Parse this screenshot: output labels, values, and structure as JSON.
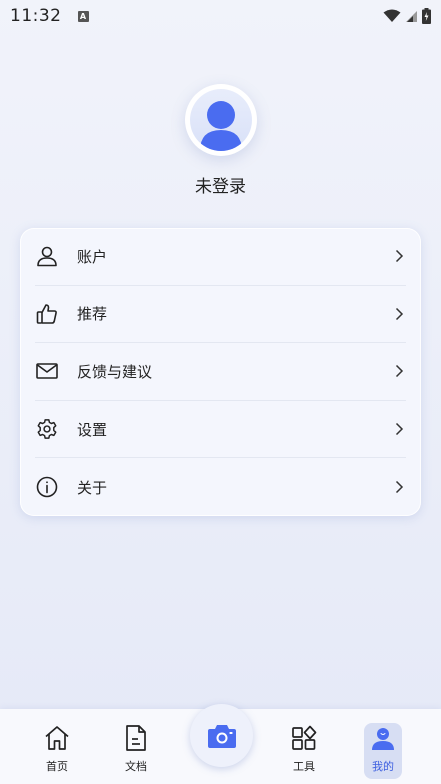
{
  "status_bar": {
    "time": "11:32",
    "notification_glyph": "A"
  },
  "profile": {
    "login_status": "未登录"
  },
  "menu": {
    "items": [
      {
        "label": "账户",
        "icon": "user-icon"
      },
      {
        "label": "推荐",
        "icon": "thumbs-up-icon"
      },
      {
        "label": "反馈与建议",
        "icon": "mail-icon"
      },
      {
        "label": "设置",
        "icon": "gear-icon"
      },
      {
        "label": "关于",
        "icon": "info-icon"
      }
    ]
  },
  "bottom_nav": {
    "items": [
      {
        "label": "首页",
        "icon": "home-icon"
      },
      {
        "label": "文档",
        "icon": "document-icon"
      },
      {
        "label": "工具",
        "icon": "tools-grid-icon"
      },
      {
        "label": "我的",
        "icon": "profile-icon",
        "active": true
      }
    ],
    "camera_icon": "camera-icon"
  },
  "colors": {
    "accent": "#3d5fe0",
    "avatar_blue": "#4a6cf0"
  }
}
